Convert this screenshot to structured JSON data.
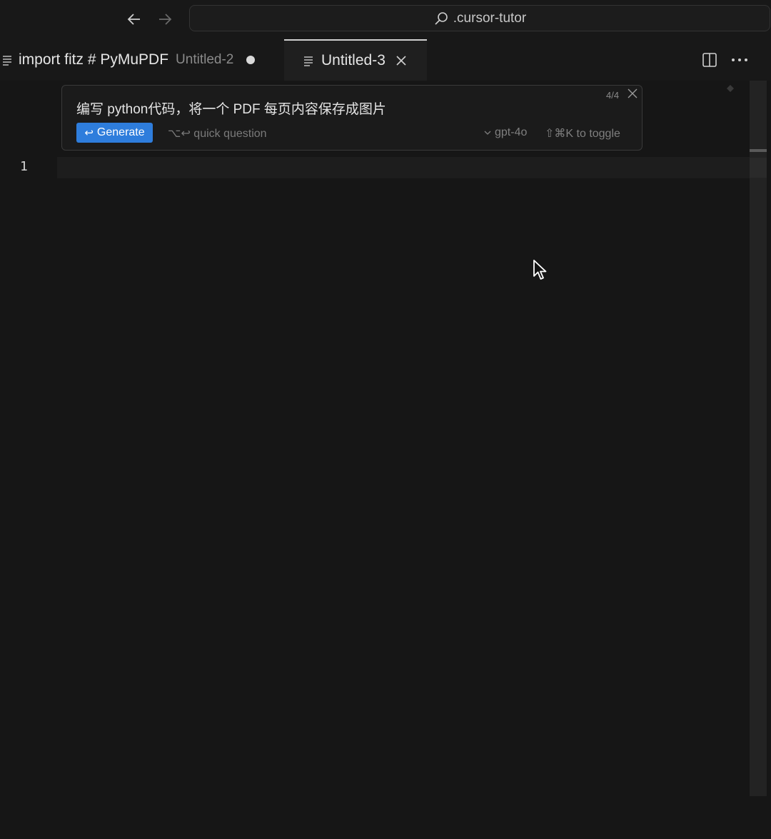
{
  "titlebar": {
    "command_center_label": ".cursor-tutor"
  },
  "tabs": [
    {
      "title": "import fitz # PyMuPDF",
      "description": "Untitled-2",
      "dirty": true,
      "active": false
    },
    {
      "title": "Untitled-3",
      "active": true
    }
  ],
  "prompt_bar": {
    "prompt": "编写 python代码，将一个 PDF 每页内容保存成图片",
    "counter": "4/4",
    "generate_label": "Generate",
    "generate_key": "↩",
    "quick_question": "⌥↩ quick question",
    "model": "gpt-4o",
    "toggle_hint": "⇧⌘K to toggle"
  },
  "editor": {
    "line_numbers": [
      "1"
    ]
  },
  "colors": {
    "accent": "#2e7ddc",
    "background": "#181818"
  }
}
